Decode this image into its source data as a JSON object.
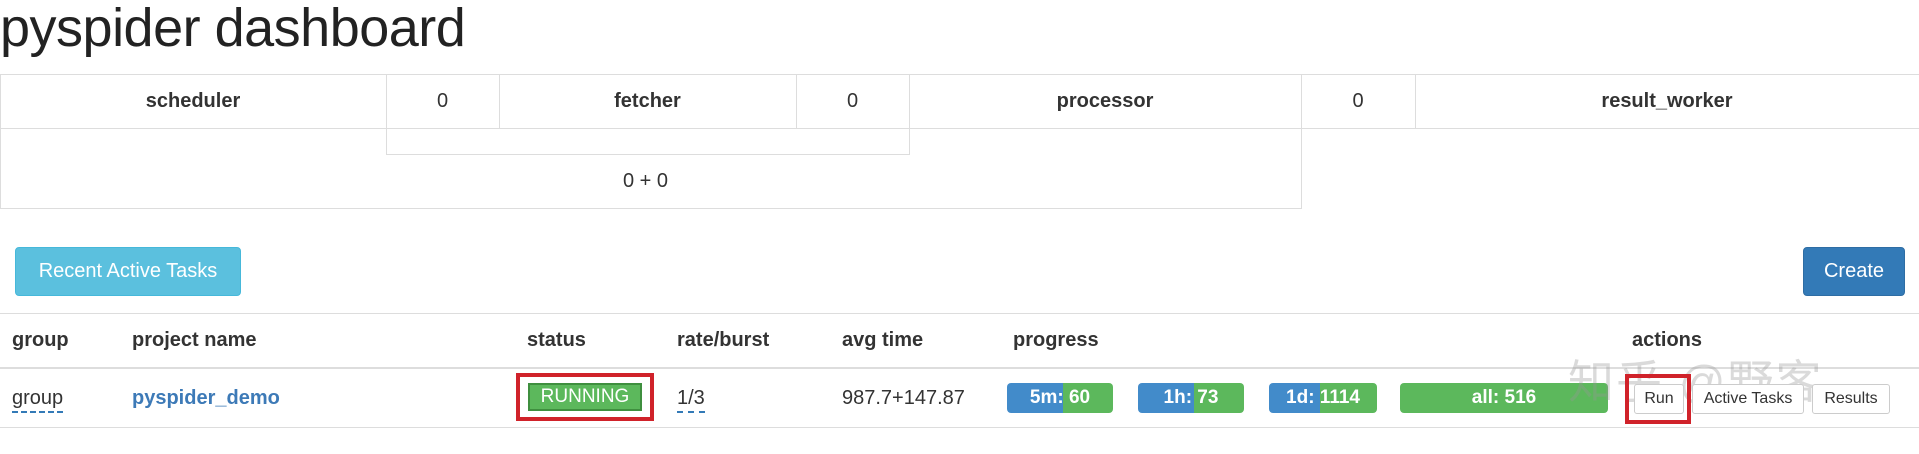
{
  "page": {
    "title": "pyspider dashboard"
  },
  "queues": {
    "scheduler_label": "scheduler",
    "scheduler_fetcher_count": "0",
    "fetcher_label": "fetcher",
    "fetcher_processor_count": "0",
    "processor_label": "processor",
    "processor_result_count": "0",
    "result_worker_label": "result_worker",
    "total": "0 + 0"
  },
  "toolbar": {
    "recent_label": "Recent Active Tasks",
    "create_label": "Create"
  },
  "projects": {
    "columns": [
      "group",
      "project name",
      "status",
      "rate/burst",
      "avg time",
      "progress",
      "actions"
    ],
    "rows": [
      {
        "group": "group",
        "name": "pyspider_demo",
        "status": "RUNNING",
        "rate_burst": "1/3",
        "avg_time": "987.7+147.87",
        "progress": [
          {
            "label": "5m: 60",
            "green_fraction": 0.47
          },
          {
            "label": "1h: 73",
            "green_fraction": 0.47
          },
          {
            "label": "1d: 1114",
            "green_fraction": 0.53
          },
          {
            "label": "all: 516",
            "green_fraction": 1.0
          }
        ],
        "actions": {
          "run": "Run",
          "active_tasks": "Active Tasks",
          "results": "Results"
        }
      }
    ]
  },
  "colors": {
    "info": "#5bc0de",
    "primary": "#337ab7",
    "success": "#5cb85c",
    "progress_blue": "#428bca",
    "highlight_red": "#d0222a"
  },
  "watermark": "知乎 @野客"
}
